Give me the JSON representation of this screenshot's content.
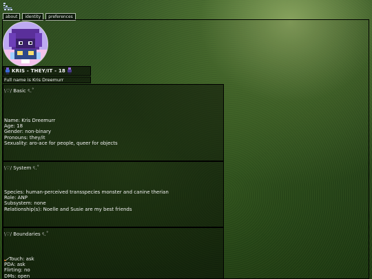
{
  "nav": {
    "tabs": [
      {
        "label": "about"
      },
      {
        "label": "identity"
      },
      {
        "label": "preferences"
      }
    ]
  },
  "profile": {
    "title": "KRIS - THEY/IT - 18",
    "fullname": "Full name is Kris Dreemurr"
  },
  "sections": {
    "basic": {
      "title_prefix": "\\♡/ ",
      "title": "Basic",
      "title_suffix": " ৎ.˚",
      "lines": [
        "Name: Kris Dreemurr",
        "Age: 18",
        "Gender: non-binary",
        "Pronouns: they/it",
        "Sexuality: aro-ace for people, queer for objects"
      ]
    },
    "system": {
      "title_prefix": "\\♡/ ",
      "title": "System",
      "title_suffix": " ৎ.˚",
      "lines": [
        "Species: human-perceived transspecies monster and canine therian",
        "Role: ANP",
        "Subsystem: none",
        "Relationship(s): Noelle and Susie are my best friends"
      ]
    },
    "boundaries": {
      "title_prefix": "\\♡/ ",
      "title": "Boundaries",
      "title_suffix": " ৎ.˚",
      "lines": [
        "Touch: ask",
        "PDA: ask",
        "Flirting: no",
        "DMs: open"
      ]
    }
  },
  "colors": {
    "panel_bg": "rgba(0,0,0,0.45)",
    "text": "#f2f2f2",
    "avatar_bg": "#b9a6f0"
  }
}
